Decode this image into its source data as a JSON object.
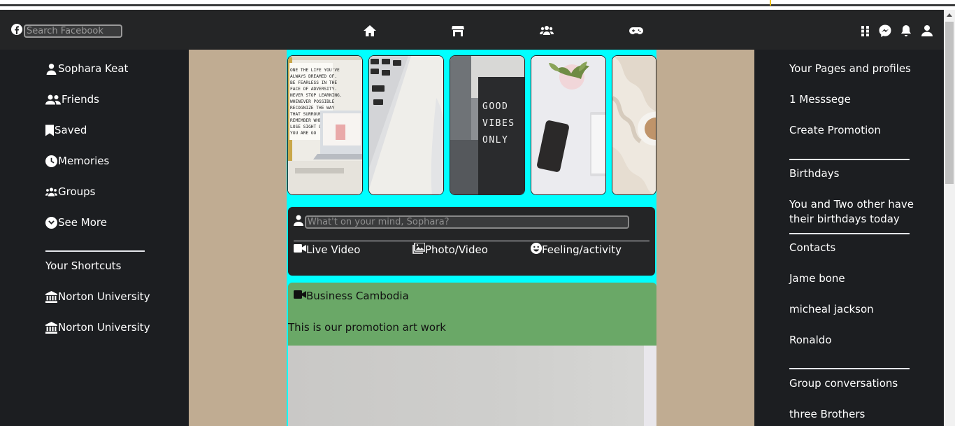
{
  "navbar": {
    "search_placeholder": "Search Facebook",
    "center_icons": [
      "home-icon",
      "marketplace-icon",
      "groups-icon",
      "gaming-icon"
    ],
    "right_icons": [
      "menu-grid-icon",
      "messenger-icon",
      "bell-icon",
      "user-icon"
    ]
  },
  "left_sidebar": {
    "items": [
      {
        "label": "Sophara Keat",
        "icon": "user-icon"
      },
      {
        "label": "Friends",
        "icon": "friends-icon"
      },
      {
        "label": "Saved",
        "icon": "bookmark-icon"
      },
      {
        "label": "Memories",
        "icon": "clock-icon"
      },
      {
        "label": "Groups",
        "icon": "groups-icon"
      },
      {
        "label": "See More",
        "icon": "chevron-down-circle-icon"
      }
    ],
    "shortcuts_title": "Your Shortcuts",
    "shortcuts": [
      {
        "label": "Norton University",
        "icon": "university-icon"
      },
      {
        "label": "Norton University",
        "icon": "university-icon"
      }
    ]
  },
  "stories": {
    "items": [
      {
        "name": "story-quote-laptop",
        "caption_lines": [
          "ONE THE LIFE YOU'VE",
          "ALWAYS DREAMED OF.",
          "BE FEARLESS IN THE",
          "FACE OF ADVERSITY.",
          "NEVER STOP LEARNING.",
          "WHENEVER POSSIBLE",
          "RECOGNIZE THE WAY",
          "THAT SURROUND",
          "REMEMBER WHE",
          "LOSE SIGHT OF",
          "YOU ARE GO"
        ]
      },
      {
        "name": "story-laptop-keyboard"
      },
      {
        "name": "story-good-vibes",
        "caption_lines": [
          "GOOD",
          "VIBES",
          "ONLY"
        ]
      },
      {
        "name": "story-phone-plant"
      },
      {
        "name": "story-coffee-blanket"
      }
    ]
  },
  "composer": {
    "placeholder": "What't on your mind, Sophara?",
    "actions": [
      {
        "label": "Live Video",
        "icon": "video-camera-icon"
      },
      {
        "label": "Photo/Video",
        "icon": "photo-icon"
      },
      {
        "label": "Feeling/activity",
        "icon": "smiley-icon"
      }
    ]
  },
  "post": {
    "author": "Business Cambodia",
    "author_icon": "video-camera-icon",
    "text": "This is our promotion art work"
  },
  "right_sidebar": {
    "pages_title": "Your Pages and profiles",
    "messages": "1 Messsege",
    "create_promotion": "Create Promotion",
    "birthdays_title": "Birthdays",
    "birthday_text": "You and Two other have their birthdays today",
    "contacts_title": "Contacts",
    "contacts": [
      "Jame bone",
      "micheal jackson",
      "Ronaldo"
    ],
    "group_conversations_title": "Group conversations",
    "groups": [
      "three Brothers"
    ]
  },
  "colors": {
    "navbar": "#242526",
    "sidebar": "#1c1e21",
    "page_background": "#c0ac92",
    "feed_background": "#00ffff",
    "post_header": "#6aa867"
  }
}
